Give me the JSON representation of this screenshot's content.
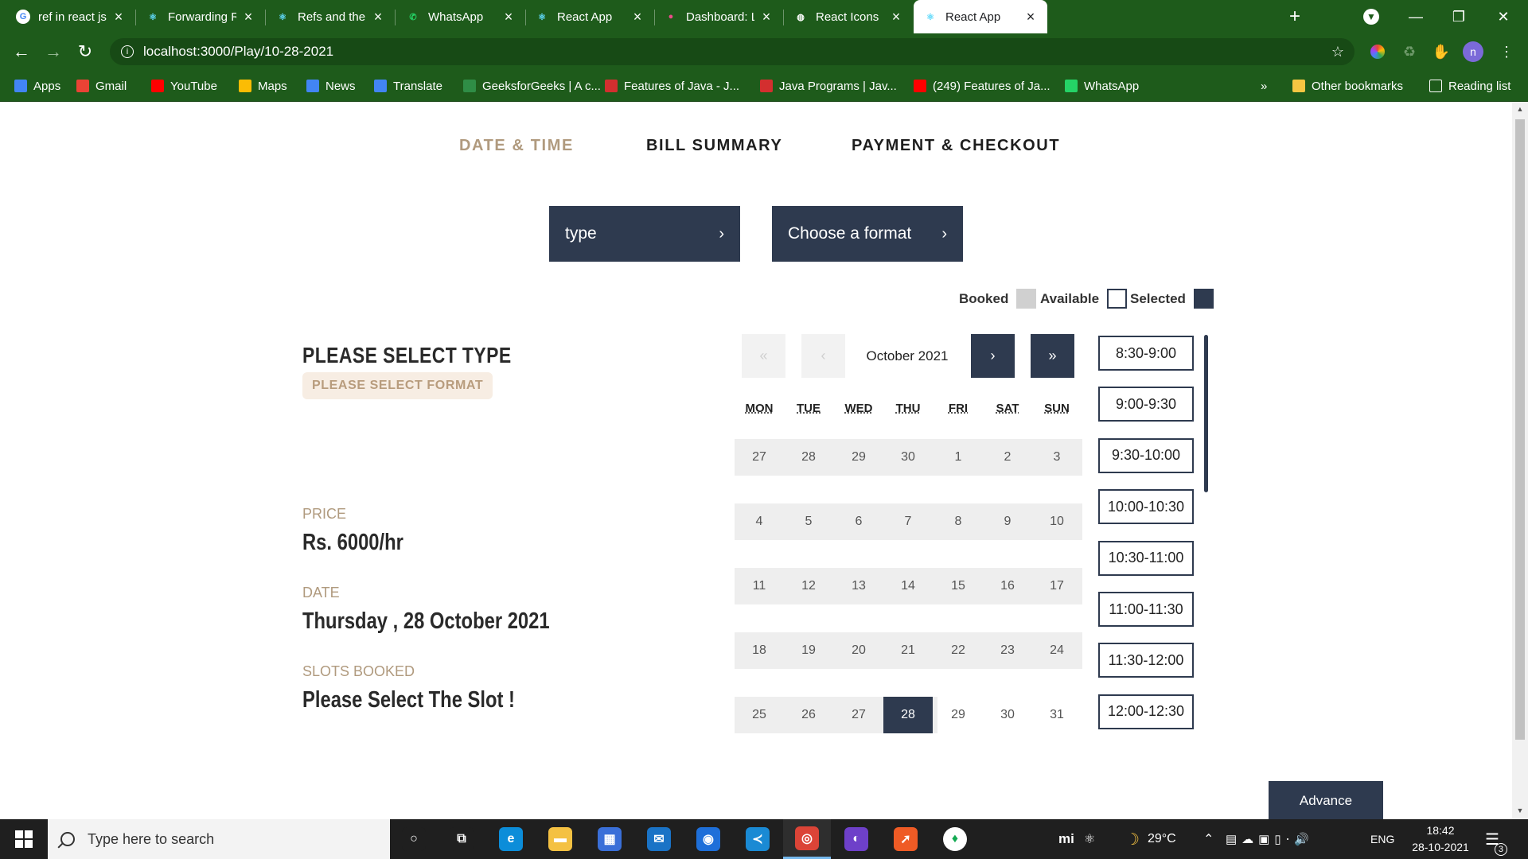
{
  "browser": {
    "tabs": [
      {
        "label": "ref in react js - Go",
        "icon": "google-icon",
        "color": "#ffffff",
        "glyph": "G"
      },
      {
        "label": "Forwarding Refs –",
        "icon": "react-icon",
        "color": "#61dafb",
        "glyph": "⚛"
      },
      {
        "label": "Refs and the DOM",
        "icon": "react-icon",
        "color": "#61dafb",
        "glyph": "⚛"
      },
      {
        "label": "WhatsApp",
        "icon": "whatsapp-icon",
        "color": "#25d366",
        "glyph": "✆"
      },
      {
        "label": "React App",
        "icon": "react-icon",
        "color": "#61dafb",
        "glyph": "⚛"
      },
      {
        "label": "Dashboard: Login",
        "icon": "dribbble-icon",
        "color": "#ea4c89",
        "glyph": "●"
      },
      {
        "label": "React Icons",
        "icon": "globe-icon",
        "color": "#ffffff",
        "glyph": "◍"
      },
      {
        "label": "React App",
        "icon": "react-icon",
        "color": "#61dafb",
        "glyph": "⚛"
      }
    ],
    "active_tab": 7,
    "new_tab_glyph": "+",
    "url": "localhost:3000/Play/10-28-2021",
    "profile_initial": "n",
    "bookmarks": [
      {
        "label": "Apps",
        "icon": "apps-grid-icon",
        "color": "#4285f4"
      },
      {
        "label": "Gmail",
        "icon": "gmail-icon",
        "color": "#ea4335"
      },
      {
        "label": "YouTube",
        "icon": "youtube-icon",
        "color": "#ff0000"
      },
      {
        "label": "Maps",
        "icon": "maps-icon",
        "color": "#fbbc04"
      },
      {
        "label": "News",
        "icon": "news-icon",
        "color": "#4285f4"
      },
      {
        "label": "Translate",
        "icon": "translate-icon",
        "color": "#4285f4"
      },
      {
        "label": "GeeksforGeeks | A c...",
        "icon": "geeksforgeeks-icon",
        "color": "#2f8d46"
      },
      {
        "label": "Features of Java - J...",
        "icon": "javatpoint-icon",
        "color": "#d32f2f"
      },
      {
        "label": "Java Programs | Jav...",
        "icon": "javatpoint-icon",
        "color": "#d32f2f"
      },
      {
        "label": "(249) Features of Ja...",
        "icon": "youtube-icon",
        "color": "#ff0000"
      },
      {
        "label": "WhatsApp",
        "icon": "whatsapp-icon",
        "color": "#25d366"
      }
    ],
    "more_bookmarks": "»",
    "other_bookmarks": "Other bookmarks",
    "reading_list": "Reading list"
  },
  "steps": [
    "DATE & TIME",
    "BILL SUMMARY",
    "PAYMENT & CHECKOUT"
  ],
  "active_step": 0,
  "dropdowns": {
    "type": "type",
    "format": "Choose a format",
    "chevron": "›"
  },
  "legend": {
    "booked": "Booked",
    "booked_color": "#d0d0d0",
    "available": "Available",
    "available_color": "#ffffff",
    "selected": "Selected",
    "selected_color": "#2e3a4f"
  },
  "info": {
    "heading": "PLEASE SELECT TYPE",
    "format_pill": "PLEASE SELECT FORMAT",
    "price_label": "PRICE",
    "price_value": "Rs. 6000/hr",
    "date_label": "DATE",
    "date_value": "Thursday , 28 October 2021",
    "slots_label": "SLOTS BOOKED",
    "slots_value": "Please Select The Slot !"
  },
  "calendar": {
    "month": "October 2021",
    "nav": {
      "prev_year": "«",
      "prev_month": "‹",
      "next_month": "›",
      "next_year": "»"
    },
    "weekdays": [
      "MON",
      "TUE",
      "WED",
      "THU",
      "FRI",
      "SAT",
      "SUN"
    ],
    "weeks": [
      [
        "27",
        "28",
        "29",
        "30",
        "1",
        "2",
        "3"
      ],
      [
        "4",
        "5",
        "6",
        "7",
        "8",
        "9",
        "10"
      ],
      [
        "11",
        "12",
        "13",
        "14",
        "15",
        "16",
        "17"
      ],
      [
        "18",
        "19",
        "20",
        "21",
        "22",
        "23",
        "24"
      ],
      [
        "25",
        "26",
        "27",
        "28",
        "29",
        "30",
        "31"
      ]
    ],
    "selected": {
      "week": 4,
      "day": 3
    }
  },
  "slots": [
    "8:30-9:00",
    "9:00-9:30",
    "9:30-10:00",
    "10:00-10:30",
    "10:30-11:00",
    "11:00-11:30",
    "11:30-12:00",
    "12:00-12:30"
  ],
  "advance_label": "Advance",
  "taskbar": {
    "search_placeholder": "Type here to search",
    "apps": [
      {
        "icon": "cortana-icon",
        "color": "#1f1f1f",
        "glyph": "○"
      },
      {
        "icon": "task-view-icon",
        "color": "#1f1f1f",
        "glyph": "⧉"
      },
      {
        "icon": "edge-icon",
        "color": "#0c8dd9",
        "glyph": "e"
      },
      {
        "icon": "file-explorer-icon",
        "color": "#f4c142",
        "glyph": "▬"
      },
      {
        "icon": "store-icon",
        "color": "#3a6fd8",
        "glyph": "▦"
      },
      {
        "icon": "mail-icon",
        "color": "#1a73c6",
        "glyph": "✉"
      },
      {
        "icon": "people-icon",
        "color": "#1e6fd9",
        "glyph": "◉"
      },
      {
        "icon": "vscode-icon",
        "color": "#1a8ad4",
        "glyph": "≺"
      },
      {
        "icon": "chrome-icon",
        "color": "#db4437",
        "glyph": "◎"
      },
      {
        "icon": "github-desktop-icon",
        "color": "#6e40c9",
        "glyph": "◐"
      },
      {
        "icon": "postman-icon",
        "color": "#ef5b25",
        "glyph": "➚"
      },
      {
        "icon": "mongodb-compass-icon",
        "color": "#ffffff",
        "glyph": "♦"
      }
    ],
    "active_app": 8,
    "tray_brand": "mi",
    "temperature": "29°C",
    "language": "ENG",
    "time": "18:42",
    "date": "28-10-2021",
    "notifications": "3"
  }
}
